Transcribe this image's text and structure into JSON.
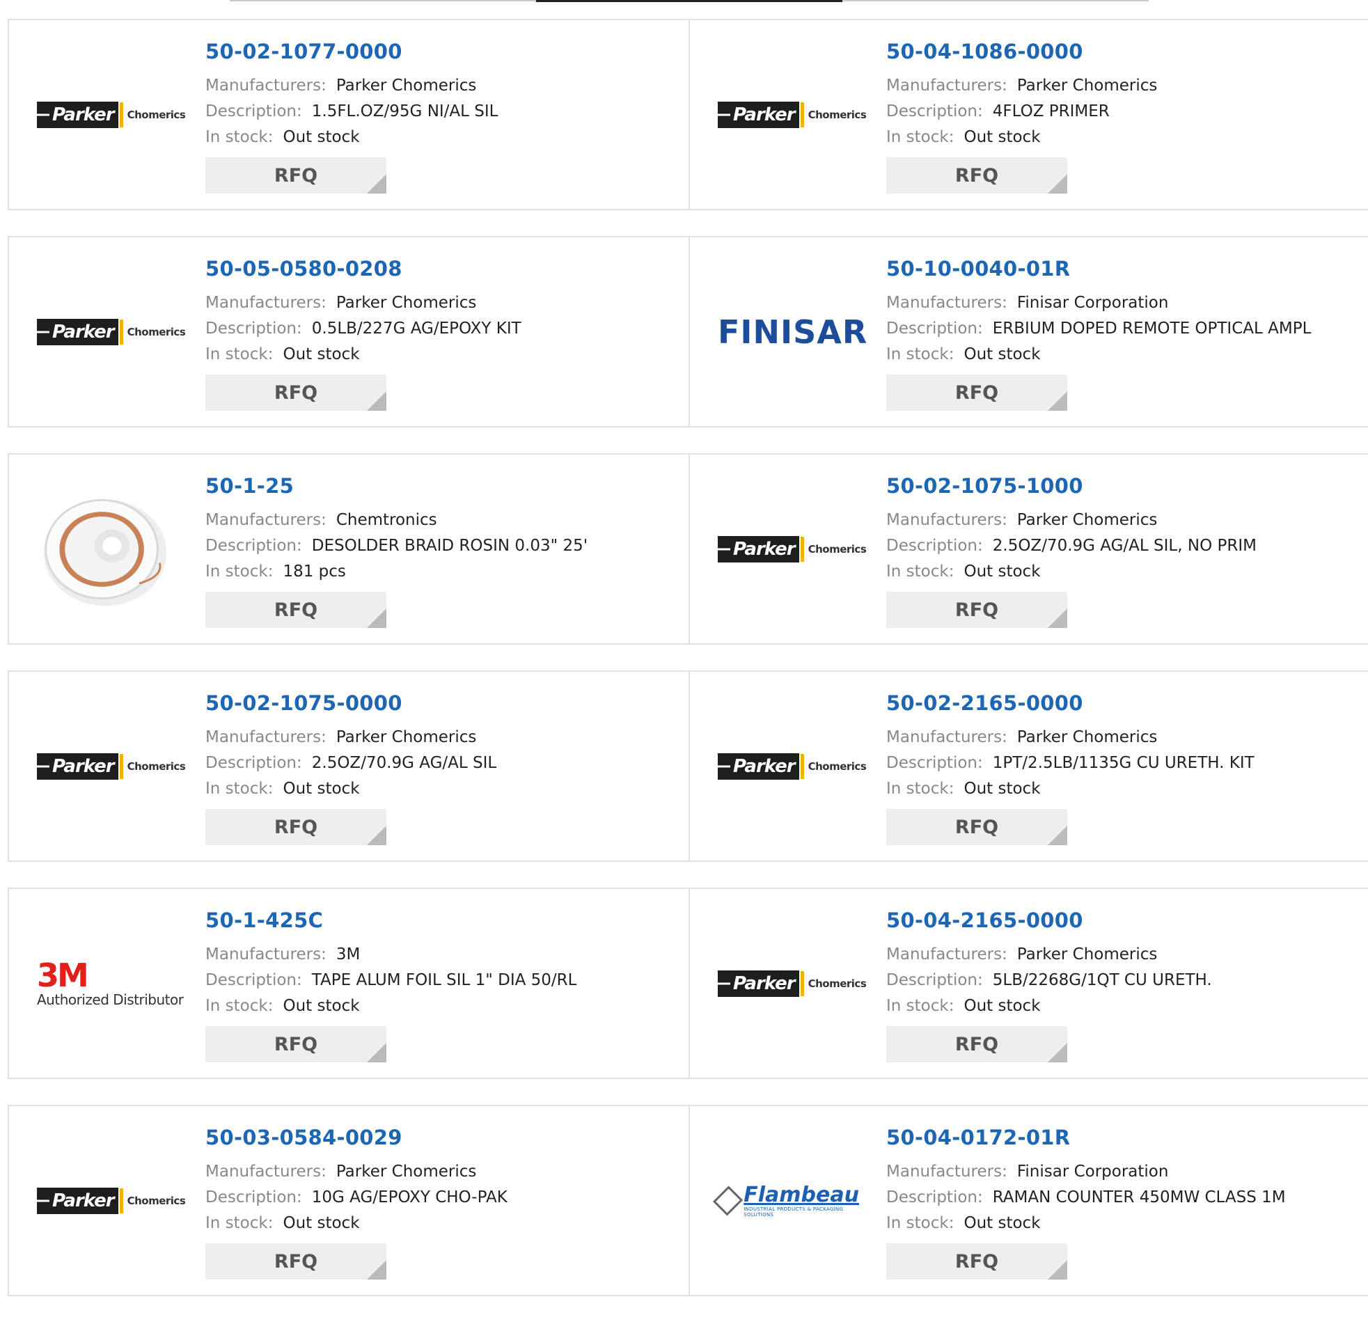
{
  "rfq_label": "RFQ",
  "labels": {
    "manufacturers": "Manufacturers:",
    "description": "Description:",
    "in_stock": "In stock:"
  },
  "logos": {
    "parker_word": "Parker",
    "parker_sub": "Chomerics",
    "finisar_word": "FINISAR",
    "three_m_word": "3M",
    "three_m_sub": "Authorized Distributor",
    "flambeau_word": "Flambeau",
    "flambeau_sub": "INDUSTRIAL PRODUCTS & PACKAGING SOLUTIONS"
  },
  "products": [
    {
      "part": "50-02-1077-0000",
      "manufacturer": "Parker Chomerics",
      "description": "1.5FL.OZ/95G NI/AL SIL",
      "stock": "Out stock",
      "logo": "parker"
    },
    {
      "part": "50-04-1086-0000",
      "manufacturer": "Parker Chomerics",
      "description": "4FLOZ PRIMER",
      "stock": "Out stock",
      "logo": "parker"
    },
    {
      "part": "50-05-0580-0208",
      "manufacturer": "Parker Chomerics",
      "description": "0.5LB/227G AG/EPOXY KIT",
      "stock": "Out stock",
      "logo": "parker"
    },
    {
      "part": "50-10-0040-01R",
      "manufacturer": "Finisar Corporation",
      "description": "ERBIUM DOPED REMOTE OPTICAL AMPL",
      "stock": "Out stock",
      "logo": "finisar"
    },
    {
      "part": "50-1-25",
      "manufacturer": "Chemtronics",
      "description": "DESOLDER BRAID ROSIN 0.03\" 25'",
      "stock": "181 pcs",
      "logo": "spool"
    },
    {
      "part": "50-02-1075-1000",
      "manufacturer": "Parker Chomerics",
      "description": "2.5OZ/70.9G AG/AL SIL, NO PRIM",
      "stock": "Out stock",
      "logo": "parker"
    },
    {
      "part": "50-02-1075-0000",
      "manufacturer": "Parker Chomerics",
      "description": "2.5OZ/70.9G AG/AL SIL",
      "stock": "Out stock",
      "logo": "parker"
    },
    {
      "part": "50-02-2165-0000",
      "manufacturer": "Parker Chomerics",
      "description": "1PT/2.5LB/1135G CU URETH. KIT",
      "stock": "Out stock",
      "logo": "parker"
    },
    {
      "part": "50-1-425C",
      "manufacturer": "3M",
      "description": "TAPE ALUM FOIL SIL 1\" DIA 50/RL",
      "stock": "Out stock",
      "logo": "3m"
    },
    {
      "part": "50-04-2165-0000",
      "manufacturer": "Parker Chomerics",
      "description": "5LB/2268G/1QT CU URETH.",
      "stock": "Out stock",
      "logo": "parker"
    },
    {
      "part": "50-03-0584-0029",
      "manufacturer": "Parker Chomerics",
      "description": "10G AG/EPOXY CHO-PAK",
      "stock": "Out stock",
      "logo": "parker"
    },
    {
      "part": "50-04-0172-01R",
      "manufacturer": "Finisar Corporation",
      "description": "RAMAN COUNTER 450MW CLASS 1M",
      "stock": "Out stock",
      "logo": "flambeau"
    }
  ]
}
